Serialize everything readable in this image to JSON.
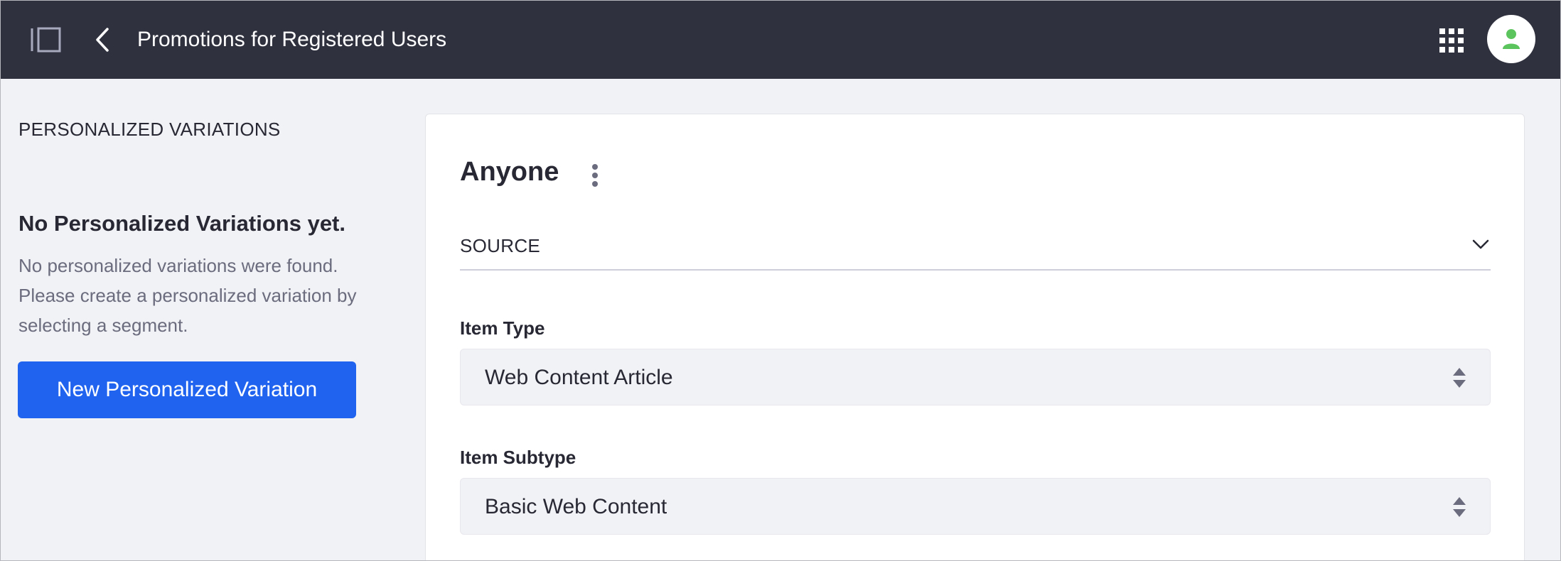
{
  "header": {
    "title": "Promotions for Registered Users",
    "icons": [
      "sidebar-toggle-icon",
      "chevron-left-icon",
      "apps-grid-icon",
      "user-avatar-icon"
    ],
    "background_color": "#30313f",
    "avatar_color": "#5cc45c"
  },
  "sidebar": {
    "heading": "PERSONALIZED VARIATIONS",
    "empty_title": "No Personalized Variations yet.",
    "empty_description": "No personalized variations were found. Please create a personalized variation by selecting a segment.",
    "new_button_label": "New Personalized Variation",
    "accent_color": "#1f63ef"
  },
  "main": {
    "heading": "Anyone",
    "source_label": "SOURCE",
    "fields": [
      {
        "label": "Item Type",
        "value": "Web Content Article"
      },
      {
        "label": "Item Subtype",
        "value": "Basic Web Content"
      }
    ]
  }
}
